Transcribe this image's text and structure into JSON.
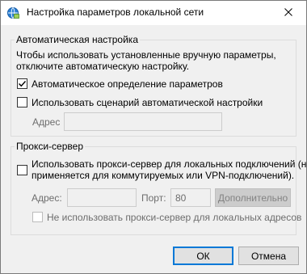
{
  "window": {
    "title": "Настройка параметров локальной сети",
    "icons": {
      "app": "network-globe-icon",
      "close": "close-icon"
    }
  },
  "auto_config": {
    "group_label": "Автоматическая настройка",
    "description_line1": "Чтобы использовать установленные вручную параметры,",
    "description_line2": "отключите автоматическую настройку.",
    "auto_detect": {
      "label": "Автоматическое определение параметров",
      "checked": true
    },
    "use_script": {
      "label": "Использовать сценарий автоматической настройки",
      "checked": false
    },
    "address": {
      "label": "Адрес",
      "value": ""
    }
  },
  "proxy": {
    "group_label": "Прокси-сервер",
    "use_proxy": {
      "label_line1": "Использовать прокси-сервер для локальных подключений (не",
      "label_line2": "применяется для коммутируемых или VPN-подключений).",
      "checked": false
    },
    "address": {
      "label": "Адрес:",
      "value": ""
    },
    "port": {
      "label": "Порт:",
      "value": "80"
    },
    "advanced_label": "Дополнительно",
    "bypass_local": {
      "label": "Не использовать прокси-сервер для локальных адресов",
      "checked": false
    }
  },
  "buttons": {
    "ok": "ОК",
    "cancel": "Отмена"
  },
  "colors": {
    "accent": "#0078d7",
    "dialog_bg": "#f0f0f0",
    "group_border": "#dcdcdc"
  }
}
